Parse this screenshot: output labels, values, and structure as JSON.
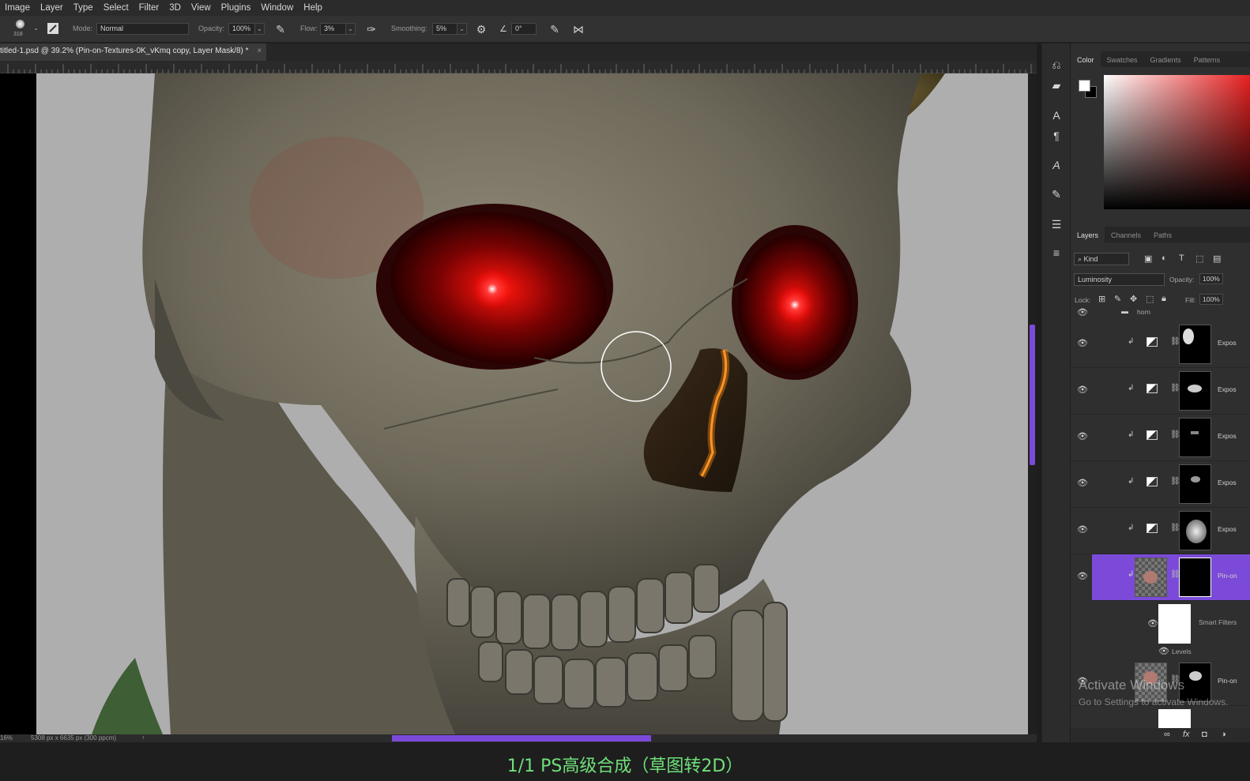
{
  "menu": [
    "Image",
    "Layer",
    "Type",
    "Select",
    "Filter",
    "3D",
    "View",
    "Plugins",
    "Window",
    "Help"
  ],
  "options": {
    "brush_size": "318",
    "mode_label": "Mode:",
    "mode_value": "Normal",
    "opacity_label": "Opacity:",
    "opacity_value": "100%",
    "flow_label": "Flow:",
    "flow_value": "3%",
    "smoothing_label": "Smoothing:",
    "smoothing_value": "5%",
    "angle_value": "0°"
  },
  "document": {
    "tab_title": "titled-1.psd @ 39.2% (Pin-on-Textures-0K_vKmq copy, Layer Mask/8) *",
    "close": "×"
  },
  "status": {
    "zoom": "16%",
    "dimensions": "5308 px x 6635 px (300 ppcm)",
    "arrow": "›"
  },
  "panels": {
    "color_tabs": [
      "Color",
      "Swatches",
      "Gradients",
      "Patterns"
    ],
    "layer_tabs": [
      "Layers",
      "Channels",
      "Paths"
    ],
    "kind": "Kind",
    "blend_mode": "Luminosity",
    "opacity_label": "Opacity:",
    "opacity_value": "100%",
    "lock_label": "Lock:",
    "fill_label": "Fill:",
    "fill_value": "100%",
    "group_name": "horn",
    "layers": [
      {
        "name": "Expos"
      },
      {
        "name": "Expos"
      },
      {
        "name": "Expos"
      },
      {
        "name": "Expos"
      },
      {
        "name": "Expos"
      },
      {
        "name": "Pin-on"
      }
    ],
    "smart_filters": "Smart Filters",
    "levels": "Levels",
    "bottom_layer": "Pin-on"
  },
  "watermark": {
    "line1": "Activate Windows",
    "line2": "Go to Settings to activate Windows."
  },
  "subtitle": "1/1 PS高级合成（草图转2D）",
  "colors": {
    "accent": "#7b4ad8",
    "subtitle": "#6fe07a",
    "eye_glow": "#ff1010"
  }
}
